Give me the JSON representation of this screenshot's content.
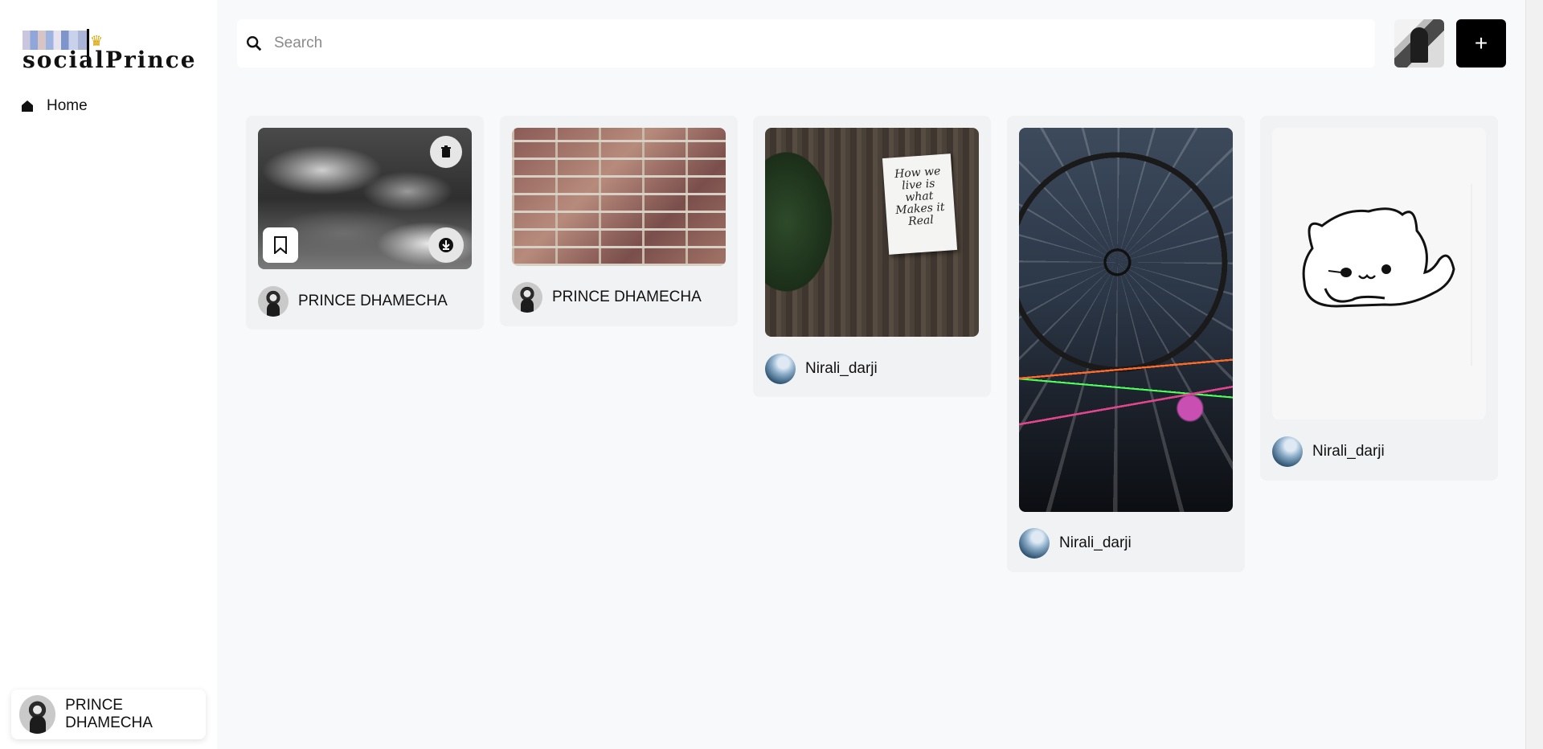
{
  "app": {
    "logo_text": "socialPrince"
  },
  "sidebar": {
    "nav": [
      {
        "label": "Home",
        "icon": "home-icon"
      }
    ],
    "profile": {
      "name": "PRINCE DHAMECHA"
    }
  },
  "topbar": {
    "search_placeholder": "Search",
    "search_value": "",
    "add_label": "+"
  },
  "pins": [
    {
      "author": "PRINCE DHAMECHA",
      "image": "stormy-clouds",
      "hovered": true
    },
    {
      "author": "PRINCE DHAMECHA",
      "image": "brick-wall"
    },
    {
      "author": "Nirali_darji",
      "image": "note-on-wood",
      "note_text": "How we live is what Makes it Real"
    },
    {
      "author": "Nirali_darji",
      "image": "ferris-wheel"
    },
    {
      "author": "Nirali_darji",
      "image": "cat-sketch"
    }
  ]
}
